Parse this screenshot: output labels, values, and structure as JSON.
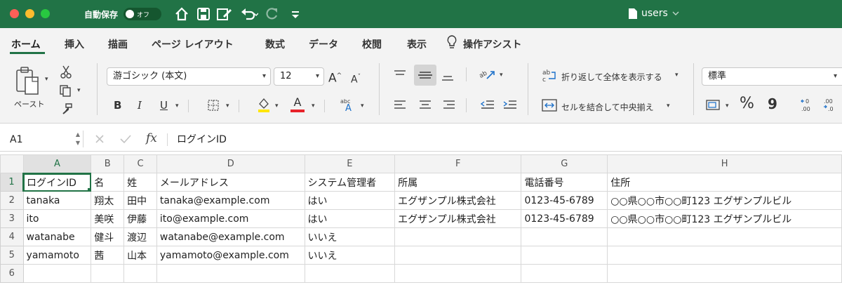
{
  "titlebar": {
    "autosave_label": "自動保存",
    "toggle_state": "オフ",
    "document_name": "users",
    "colors": {
      "bar": "#217346",
      "close": "#ff5f57",
      "minimize": "#febc2e",
      "zoom": "#28c840"
    }
  },
  "tabs": [
    {
      "label": "ホーム"
    },
    {
      "label": "挿入"
    },
    {
      "label": "描画"
    },
    {
      "label": "ページ レイアウト"
    },
    {
      "label": "数式"
    },
    {
      "label": "データ"
    },
    {
      "label": "校閲"
    },
    {
      "label": "表示"
    },
    {
      "label": "操作アシスト"
    }
  ],
  "ribbon": {
    "paste_label": "ペースト",
    "font_name": "游ゴシック (本文)",
    "font_size": "12",
    "bold": "B",
    "italic": "I",
    "underline": "U",
    "font_color_letter": "A",
    "wrap_text_label": "折り返して全体を表示する",
    "merge_label": "セルを結合して中央揃え",
    "number_format": "標準",
    "percent": "%",
    "comma": "9",
    "icons": [
      "clipboard-icon",
      "scissors-icon",
      "copy-icon",
      "format-painter-icon",
      "grow-font-icon",
      "shrink-font-icon",
      "borders-icon",
      "fill-color-icon",
      "font-color-icon",
      "phonetic-icon",
      "align-top-icon",
      "align-middle-icon",
      "align-bottom-icon",
      "orientation-icon",
      "align-left-icon",
      "align-center-icon",
      "align-right-icon",
      "decrease-indent-icon",
      "increase-indent-icon",
      "wrap-text-icon",
      "merge-icon",
      "accounting-format-icon",
      "increase-decimal-icon",
      "decrease-decimal-icon"
    ]
  },
  "formula_bar": {
    "name_box": "A1",
    "fx": "fx",
    "formula": "ログインID"
  },
  "sheet": {
    "columns": [
      "A",
      "B",
      "C",
      "D",
      "E",
      "F",
      "G",
      "H"
    ],
    "rows": [
      {
        "num": "1",
        "cells": [
          "ログインID",
          "名",
          "姓",
          "メールアドレス",
          "システム管理者",
          "所属",
          "電話番号",
          "住所"
        ]
      },
      {
        "num": "2",
        "cells": [
          "tanaka",
          "翔太",
          "田中",
          "tanaka@example.com",
          "はい",
          "エグザンプル株式会社",
          "0123-45-6789",
          "○○県○○市○○町123 エグザンプルビル"
        ]
      },
      {
        "num": "3",
        "cells": [
          "ito",
          "美咲",
          "伊藤",
          "ito@example.com",
          "はい",
          "エグザンプル株式会社",
          "0123-45-6789",
          "○○県○○市○○町123 エグザンプルビル"
        ]
      },
      {
        "num": "4",
        "cells": [
          "watanabe",
          "健斗",
          "渡辺",
          "watanabe@example.com",
          "いいえ",
          "",
          "",
          ""
        ]
      },
      {
        "num": "5",
        "cells": [
          "yamamoto",
          "茜",
          "山本",
          "yamamoto@example.com",
          "いいえ",
          "",
          "",
          ""
        ]
      },
      {
        "num": "6",
        "cells": [
          "",
          "",
          "",
          "",
          "",
          "",
          "",
          ""
        ]
      }
    ],
    "accent": "#217346"
  }
}
